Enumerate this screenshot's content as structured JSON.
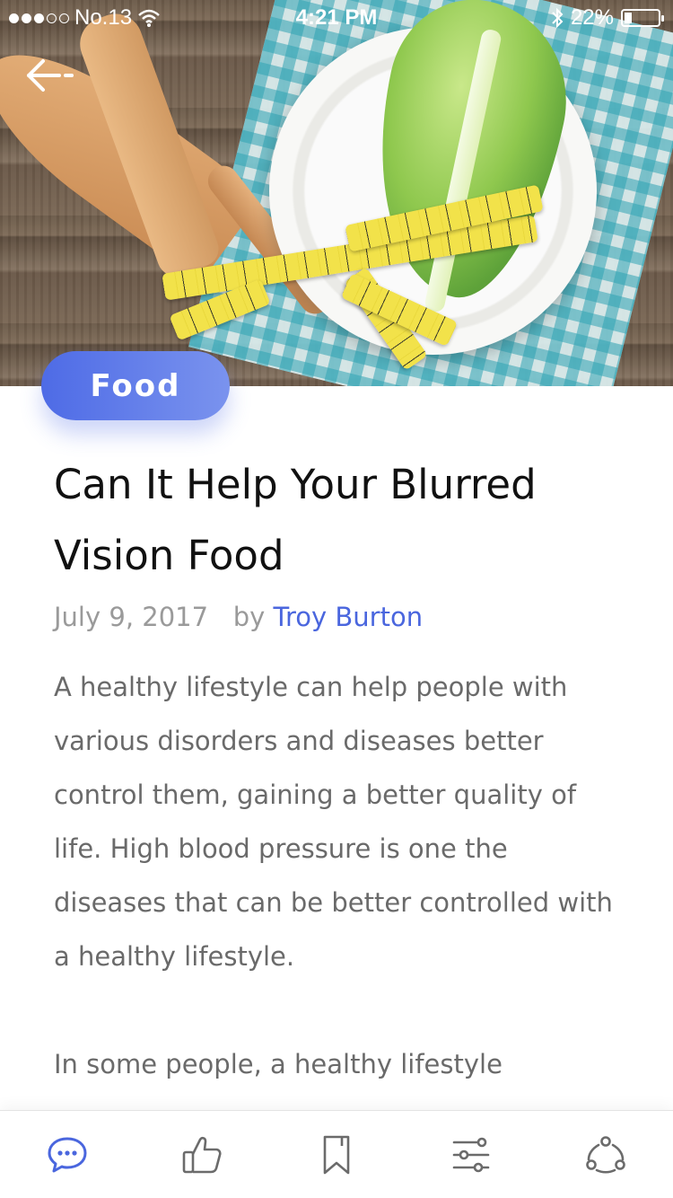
{
  "status_bar": {
    "carrier": "No.13",
    "time": "4:21 PM",
    "battery": "22%",
    "battery_level": 0.22,
    "signal_bars_filled": 3,
    "signal_bars_total": 5,
    "icons": [
      "wifi-icon",
      "bluetooth-icon",
      "battery-icon"
    ]
  },
  "header": {
    "back_icon": "back-arrow-icon"
  },
  "article": {
    "category": "Food",
    "title": "Can It Help Your Blurred Vision Food",
    "date": "July 9, 2017",
    "by_label": "by",
    "author": "Troy Burton",
    "paragraphs": [
      "A healthy lifestyle can help people with various disorders and diseases better control them, gaining a better quality of life. High blood pressure is one the diseases that can be better controlled with a healthy lifestyle.",
      "In some people, a healthy lifestyle"
    ]
  },
  "tab_bar": {
    "tabs": [
      {
        "icon": "comment-icon",
        "active": true
      },
      {
        "icon": "thumbs-up-icon",
        "active": false
      },
      {
        "icon": "bookmark-icon",
        "active": false
      },
      {
        "icon": "sliders-icon",
        "active": false
      },
      {
        "icon": "share-icon",
        "active": false
      }
    ]
  },
  "colors": {
    "accent": "#4a66de",
    "pill_gradient_start": "#4e6be6",
    "pill_gradient_end": "#7a93ee",
    "title": "#111111",
    "body": "#6a6a6a",
    "meta": "#9a9a9a",
    "icon_inactive": "#6b6b6b"
  }
}
